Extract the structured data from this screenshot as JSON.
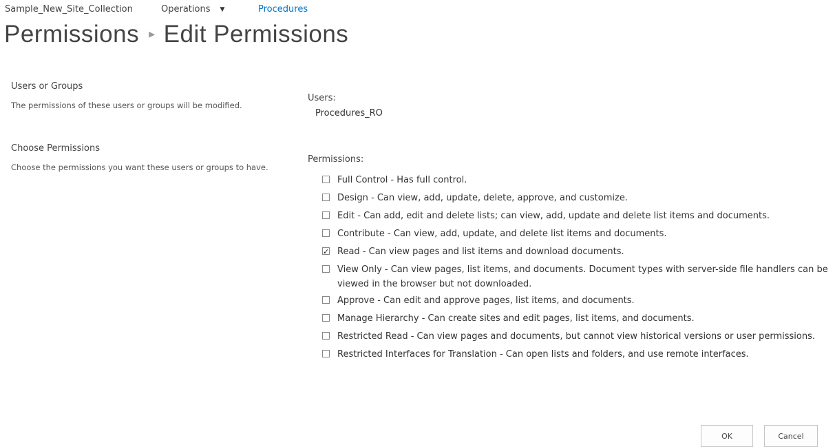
{
  "nav": {
    "site": "Sample_New_Site_Collection",
    "operations": "Operations",
    "procedures": "Procedures"
  },
  "title": {
    "parent": "Permissions",
    "current": "Edit Permissions"
  },
  "users_section": {
    "title": "Users or Groups",
    "description": "The permissions of these users or groups will be modified.",
    "label": "Users:",
    "value": "Procedures_RO"
  },
  "permissions_section": {
    "title": "Choose Permissions",
    "description": "Choose the permissions you want these users or groups to have.",
    "label": "Permissions:",
    "items": [
      {
        "label": "Full Control - Has full control.",
        "checked": false
      },
      {
        "label": "Design - Can view, add, update, delete, approve, and customize.",
        "checked": false
      },
      {
        "label": "Edit - Can add, edit and delete lists; can view, add, update and delete list items and documents.",
        "checked": false
      },
      {
        "label": "Contribute - Can view, add, update, and delete list items and documents.",
        "checked": false
      },
      {
        "label": "Read - Can view pages and list items and download documents.",
        "checked": true
      },
      {
        "label": "View Only - Can view pages, list items, and documents. Document types with server-side file handlers can be viewed in the browser but not downloaded.",
        "checked": false
      },
      {
        "label": "Approve - Can edit and approve pages, list items, and documents.",
        "checked": false
      },
      {
        "label": "Manage Hierarchy - Can create sites and edit pages, list items, and documents.",
        "checked": false
      },
      {
        "label": "Restricted Read - Can view pages and documents, but cannot view historical versions or user permissions.",
        "checked": false
      },
      {
        "label": "Restricted Interfaces for Translation - Can open lists and folders, and use remote interfaces.",
        "checked": false
      }
    ]
  },
  "buttons": {
    "ok": "OK",
    "cancel": "Cancel"
  }
}
